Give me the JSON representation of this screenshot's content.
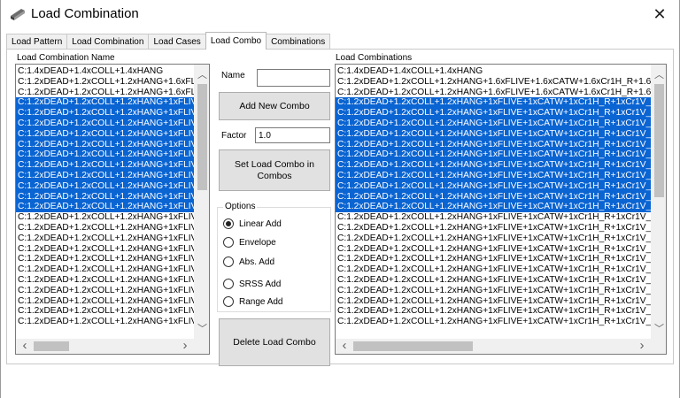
{
  "window": {
    "title": "Load Combination",
    "close_glyph": "✕",
    "icon": "load-combination-app-icon"
  },
  "tabs": [
    {
      "label": "Load Pattern",
      "active": false
    },
    {
      "label": "Load Combination",
      "active": false
    },
    {
      "label": "Load Cases",
      "active": false
    },
    {
      "label": "Load Combo",
      "active": true
    },
    {
      "label": "Combinations",
      "active": false
    }
  ],
  "left_list": {
    "title": "Load Combination Name",
    "items": [
      {
        "text": "C:1.4xDEAD+1.4xCOLL+1.4xHANG",
        "selected": false
      },
      {
        "text": "C:1.2xDEAD+1.2xCOLL+1.2xHANG+1.6xFLIVE",
        "selected": false
      },
      {
        "text": "C:1.2xDEAD+1.2xCOLL+1.2xHANG+1.6xFLIVE",
        "selected": false
      },
      {
        "text": "C:1.2xDEAD+1.2xCOLL+1.2xHANG+1xFLIVE",
        "selected": true
      },
      {
        "text": "C:1.2xDEAD+1.2xCOLL+1.2xHANG+1xFLIVE",
        "selected": true
      },
      {
        "text": "C:1.2xDEAD+1.2xCOLL+1.2xHANG+1xFLIVE",
        "selected": true
      },
      {
        "text": "C:1.2xDEAD+1.2xCOLL+1.2xHANG+1xFLIVE",
        "selected": true
      },
      {
        "text": "C:1.2xDEAD+1.2xCOLL+1.2xHANG+1xFLIVE",
        "selected": true
      },
      {
        "text": "C:1.2xDEAD+1.2xCOLL+1.2xHANG+1xFLIVE",
        "selected": true
      },
      {
        "text": "C:1.2xDEAD+1.2xCOLL+1.2xHANG+1xFLIVE",
        "selected": true
      },
      {
        "text": "C:1.2xDEAD+1.2xCOLL+1.2xHANG+1xFLIVE",
        "selected": true
      },
      {
        "text": "C:1.2xDEAD+1.2xCOLL+1.2xHANG+1xFLIVE",
        "selected": true
      },
      {
        "text": "C:1.2xDEAD+1.2xCOLL+1.2xHANG+1xFLIVE",
        "selected": true
      },
      {
        "text": "C:1.2xDEAD+1.2xCOLL+1.2xHANG+1xFLIVE",
        "selected": true
      },
      {
        "text": "C:1.2xDEAD+1.2xCOLL+1.2xHANG+1xFLIVE",
        "selected": false
      },
      {
        "text": "C:1.2xDEAD+1.2xCOLL+1.2xHANG+1xFLIVE",
        "selected": false
      },
      {
        "text": "C:1.2xDEAD+1.2xCOLL+1.2xHANG+1xFLIVE",
        "selected": false
      },
      {
        "text": "C:1.2xDEAD+1.2xCOLL+1.2xHANG+1xFLIVE",
        "selected": false
      },
      {
        "text": "C:1.2xDEAD+1.2xCOLL+1.2xHANG+1xFLIVE",
        "selected": false
      },
      {
        "text": "C:1.2xDEAD+1.2xCOLL+1.2xHANG+1xFLIVE",
        "selected": false
      },
      {
        "text": "C:1.2xDEAD+1.2xCOLL+1.2xHANG+1xFLIVE",
        "selected": false
      },
      {
        "text": "C:1.2xDEAD+1.2xCOLL+1.2xHANG+1xFLIVE",
        "selected": false
      },
      {
        "text": "C:1.2xDEAD+1.2xCOLL+1.2xHANG+1xFLIVE",
        "selected": false
      },
      {
        "text": "C:1.2xDEAD+1.2xCOLL+1.2xHANG+1xFLIVE",
        "selected": false
      },
      {
        "text": "C:1.2xDEAD+1.2xCOLL+1.2xHANG+1xFLIVE",
        "selected": false
      }
    ]
  },
  "middle": {
    "name_label": "Name",
    "name_value": "",
    "add_button": "Add New Combo",
    "factor_label": "Factor",
    "factor_value": "1.0",
    "set_button": "Set Load Combo in Combos",
    "options_title": "Options",
    "options": [
      {
        "label": "Linear Add",
        "checked": true
      },
      {
        "label": "Envelope",
        "checked": false
      },
      {
        "label": "Abs. Add",
        "checked": false
      },
      {
        "label": "SRSS Add",
        "checked": false
      },
      {
        "label": "Range Add",
        "checked": false
      }
    ],
    "delete_button": "Delete Load Combo"
  },
  "right_list": {
    "title": "Load Combinations",
    "items": [
      {
        "text": "C:1.4xDEAD+1.4xCOLL+1.4xHANG",
        "selected": false
      },
      {
        "text": "C:1.2xDEAD+1.2xCOLL+1.2xHANG+1.6xFLIVE+1.6xCATW+1.6xCr1H_R+1.6",
        "selected": false
      },
      {
        "text": "C:1.2xDEAD+1.2xCOLL+1.2xHANG+1.6xFLIVE+1.6xCATW+1.6xCr1H_R+1.6",
        "selected": false
      },
      {
        "text": "C:1.2xDEAD+1.2xCOLL+1.2xHANG+1xFLIVE+1xCATW+1xCr1H_R+1xCr1V_",
        "selected": true
      },
      {
        "text": "C:1.2xDEAD+1.2xCOLL+1.2xHANG+1xFLIVE+1xCATW+1xCr1H_R+1xCr1V_",
        "selected": true
      },
      {
        "text": "C:1.2xDEAD+1.2xCOLL+1.2xHANG+1xFLIVE+1xCATW+1xCr1H_R+1xCr1V_",
        "selected": true
      },
      {
        "text": "C:1.2xDEAD+1.2xCOLL+1.2xHANG+1xFLIVE+1xCATW+1xCr1H_R+1xCr1V_",
        "selected": true
      },
      {
        "text": "C:1.2xDEAD+1.2xCOLL+1.2xHANG+1xFLIVE+1xCATW+1xCr1H_R+1xCr1V_",
        "selected": true
      },
      {
        "text": "C:1.2xDEAD+1.2xCOLL+1.2xHANG+1xFLIVE+1xCATW+1xCr1H_R+1xCr1V_",
        "selected": true
      },
      {
        "text": "C:1.2xDEAD+1.2xCOLL+1.2xHANG+1xFLIVE+1xCATW+1xCr1H_R+1xCr1V_",
        "selected": true
      },
      {
        "text": "C:1.2xDEAD+1.2xCOLL+1.2xHANG+1xFLIVE+1xCATW+1xCr1H_R+1xCr1V_",
        "selected": true
      },
      {
        "text": "C:1.2xDEAD+1.2xCOLL+1.2xHANG+1xFLIVE+1xCATW+1xCr1H_R+1xCr1V_",
        "selected": true
      },
      {
        "text": "C:1.2xDEAD+1.2xCOLL+1.2xHANG+1xFLIVE+1xCATW+1xCr1H_R+1xCr1V_",
        "selected": true
      },
      {
        "text": "C:1.2xDEAD+1.2xCOLL+1.2xHANG+1xFLIVE+1xCATW+1xCr1H_R+1xCr1V_",
        "selected": true
      },
      {
        "text": "C:1.2xDEAD+1.2xCOLL+1.2xHANG+1xFLIVE+1xCATW+1xCr1H_R+1xCr1V_",
        "selected": false
      },
      {
        "text": "C:1.2xDEAD+1.2xCOLL+1.2xHANG+1xFLIVE+1xCATW+1xCr1H_R+1xCr1V_",
        "selected": false
      },
      {
        "text": "C:1.2xDEAD+1.2xCOLL+1.2xHANG+1xFLIVE+1xCATW+1xCr1H_R+1xCr1V_",
        "selected": false
      },
      {
        "text": "C:1.2xDEAD+1.2xCOLL+1.2xHANG+1xFLIVE+1xCATW+1xCr1H_R+1xCr1V_",
        "selected": false
      },
      {
        "text": "C:1.2xDEAD+1.2xCOLL+1.2xHANG+1xFLIVE+1xCATW+1xCr1H_R+1xCr1V_",
        "selected": false
      },
      {
        "text": "C:1.2xDEAD+1.2xCOLL+1.2xHANG+1xFLIVE+1xCATW+1xCr1H_R+1xCr1V_",
        "selected": false
      },
      {
        "text": "C:1.2xDEAD+1.2xCOLL+1.2xHANG+1xFLIVE+1xCATW+1xCr1H_R+1xCr1V_",
        "selected": false
      },
      {
        "text": "C:1.2xDEAD+1.2xCOLL+1.2xHANG+1xFLIVE+1xCATW+1xCr1H_R+1xCr1V_",
        "selected": false
      },
      {
        "text": "C:1.2xDEAD+1.2xCOLL+1.2xHANG+1xFLIVE+1xCATW+1xCr1H_R+1xCr1V_",
        "selected": false
      },
      {
        "text": "C:1.2xDEAD+1.2xCOLL+1.2xHANG+1xFLIVE+1xCATW+1xCr1H_R+1xCr1V_",
        "selected": false
      },
      {
        "text": "C:1.2xDEAD+1.2xCOLL+1.2xHANG+1xFLIVE+1xCATW+1xCr1H_R+1xCr1V_",
        "selected": false
      }
    ]
  },
  "scroll_glyphs": {
    "up": "︿",
    "down": "﹀",
    "left": "‹",
    "right": "›"
  },
  "colors": {
    "selection": "#0a64d2",
    "button_face": "#e1e1e1",
    "scrollbar_track": "#f0f0f0",
    "scrollbar_thumb": "#c1c1c1"
  }
}
